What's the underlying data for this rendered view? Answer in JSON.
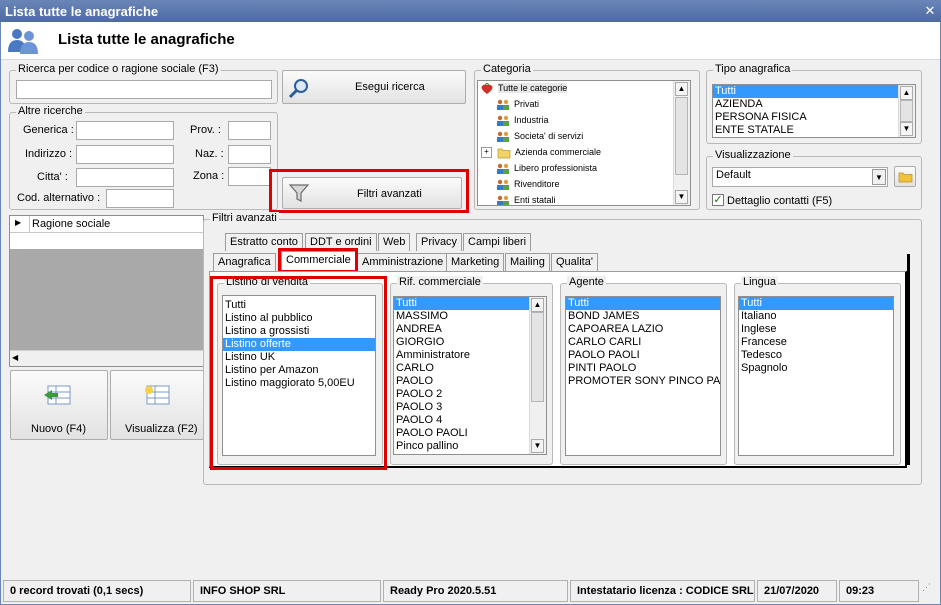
{
  "window": {
    "title": "Lista tutte le anagrafiche",
    "header_title": "Lista tutte le anagrafiche"
  },
  "search": {
    "code_group_label": "Ricerca per codice o ragione sociale (F3)",
    "code_value": "",
    "search_button": "Esegui ricerca",
    "other_group_label": "Altre ricerche",
    "fields": {
      "generica": "Generica :",
      "indirizzo": "Indirizzo :",
      "citta": "Citta' :",
      "cod_alternativo": "Cod. alternativo :",
      "prov": "Prov. :",
      "naz": "Naz. :",
      "zona": "Zona :"
    },
    "advanced_button": "Filtri avanzati"
  },
  "categoria": {
    "label": "Categoria",
    "items": [
      "Tutte le categorie",
      "Privati",
      "Industria",
      "Societa' di servizi",
      "Azienda commerciale",
      "Libero professionista",
      "Rivenditore",
      "Enti statali"
    ]
  },
  "tipo_anagrafica": {
    "label": "Tipo anagrafica",
    "items": [
      "Tutti",
      "AZIENDA",
      "PERSONA FISICA",
      "ENTE STATALE"
    ],
    "selected": "Tutti"
  },
  "visualizzazione": {
    "label": "Visualizzazione",
    "value": "Default",
    "checkbox_label": "Dettaglio contatti (F5)",
    "checked": true
  },
  "grid": {
    "column_header": "Ragione sociale"
  },
  "actions": {
    "new_button": "Nuovo (F4)",
    "view_button": "Visualizza (F2)"
  },
  "filters": {
    "group_label": "Filtri avanzati",
    "tabs_row1": [
      "Estratto conto",
      "DDT e ordini",
      "Web",
      "Privacy",
      "Campi liberi"
    ],
    "tabs_row2": [
      "Anagrafica",
      "Commerciale",
      "Amministrazione",
      "Marketing",
      "Mailing",
      "Qualita'"
    ],
    "active_tab": "Commerciale",
    "listino": {
      "label": "Listino di vendita",
      "items": [
        "Tutti",
        "Listino al pubblico",
        "Listino a grossisti",
        "Listino offerte",
        "Listino UK",
        "Listino per Amazon",
        "Listino maggiorato 5,00EU"
      ],
      "selected": "Listino offerte"
    },
    "rif_commerciale": {
      "label": "Rif. commerciale",
      "items": [
        "Tutti",
        "MASSIMO",
        "ANDREA",
        "GIORGIO",
        "Amministratore",
        "CARLO",
        "PAOLO",
        "PAOLO 2",
        "PAOLO 3",
        "PAOLO 4",
        "PAOLO PAOLI",
        "Pinco pallino"
      ],
      "selected": "Tutti"
    },
    "agente": {
      "label": "Agente",
      "items": [
        "Tutti",
        "BOND JAMES",
        "CAPOAREA LAZIO",
        "CARLO CARLI",
        "PAOLO PAOLI",
        "PINTI PAOLO",
        "PROMOTER SONY PINCO PALLI"
      ],
      "selected": "Tutti"
    },
    "lingua": {
      "label": "Lingua",
      "items": [
        "Tutti",
        "Italiano",
        "Inglese",
        "Francese",
        "Tedesco",
        "Spagnolo"
      ],
      "selected": "Tutti"
    }
  },
  "status": {
    "records": "0 record trovati (0,1 secs)",
    "company": "INFO SHOP SRL",
    "version": "Ready Pro 2020.5.51",
    "license": "Intestatario licenza : CODICE SRL",
    "date": "21/07/2020",
    "time": "09:23"
  },
  "colors": {
    "title_bar": "#4d6aa3",
    "selection": "#3399ff",
    "highlight": "#e00000"
  }
}
